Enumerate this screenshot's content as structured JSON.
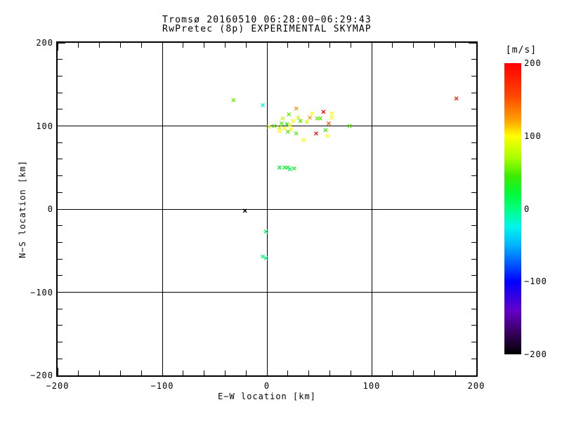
{
  "chart_data": {
    "type": "scatter",
    "title": "Tromsø 20160510 06:28:00−06:29:43",
    "subtitle": "RwPretec (8p) EXPERIMENTAL SKYMAP",
    "xlabel": "E−W location [km]",
    "ylabel": "N−S location [km]",
    "xlim": [
      -200,
      200
    ],
    "ylim": [
      -200,
      200
    ],
    "xticks": [
      -200,
      -100,
      0,
      100,
      200
    ],
    "yticks": [
      -200,
      -100,
      0,
      100,
      200
    ],
    "minor_tick_step": 20,
    "grid": true,
    "marker": "x",
    "background": "#ffffff",
    "axis_color": "#000000",
    "colorbar": {
      "label": "[m/s]",
      "ticks": [
        200,
        100,
        0,
        -100,
        -200
      ],
      "range": [
        -200,
        200
      ]
    },
    "colormap_stops": [
      [
        200,
        "#ff0000"
      ],
      [
        155,
        "#ff4600"
      ],
      [
        120,
        "#ffa500"
      ],
      [
        100,
        "#ffff00"
      ],
      [
        70,
        "#aaff00"
      ],
      [
        45,
        "#3ceb00"
      ],
      [
        20,
        "#00fa3c"
      ],
      [
        0,
        "#00ff82"
      ],
      [
        -25,
        "#00f5eb"
      ],
      [
        -50,
        "#00b4ff"
      ],
      [
        -75,
        "#005aff"
      ],
      [
        -100,
        "#0000ff"
      ],
      [
        -140,
        "#6400c8"
      ],
      [
        -170,
        "#37005f"
      ],
      [
        -200,
        "#000000"
      ]
    ],
    "points_format": [
      "ew_km",
      "ns_km",
      "velocity_ms"
    ],
    "points": [
      [
        -32,
        131,
        55
      ],
      [
        -4,
        125,
        -25
      ],
      [
        181,
        133,
        180
      ],
      [
        -21,
        -2,
        -200
      ],
      [
        -1,
        -27,
        10
      ],
      [
        -4,
        -57,
        5
      ],
      [
        -1,
        -59,
        0
      ],
      [
        12,
        50,
        20
      ],
      [
        17,
        50,
        25
      ],
      [
        20,
        50,
        30
      ],
      [
        22,
        48,
        5
      ],
      [
        26,
        49,
        35
      ],
      [
        28,
        121,
        125
      ],
      [
        21,
        114,
        50
      ],
      [
        15,
        109,
        80
      ],
      [
        30,
        110,
        80
      ],
      [
        25,
        106,
        100
      ],
      [
        32,
        106,
        50
      ],
      [
        38,
        105,
        80
      ],
      [
        14,
        103,
        50
      ],
      [
        19,
        102,
        30
      ],
      [
        22,
        101,
        100
      ],
      [
        12,
        98,
        80
      ],
      [
        7,
        100,
        50
      ],
      [
        2,
        99,
        80
      ],
      [
        17,
        97,
        100
      ],
      [
        23,
        96,
        100
      ],
      [
        12,
        94,
        100
      ],
      [
        20,
        93,
        50
      ],
      [
        28,
        91,
        50
      ],
      [
        35,
        83,
        100
      ],
      [
        43,
        115,
        100
      ],
      [
        41,
        110,
        125
      ],
      [
        54,
        117,
        195
      ],
      [
        48,
        109,
        50
      ],
      [
        51,
        109,
        50
      ],
      [
        62,
        115,
        100
      ],
      [
        62,
        110,
        100
      ],
      [
        59,
        103,
        150
      ],
      [
        56,
        95,
        45
      ],
      [
        79,
        100,
        50
      ],
      [
        47,
        91,
        195
      ],
      [
        58,
        88,
        100
      ]
    ]
  }
}
